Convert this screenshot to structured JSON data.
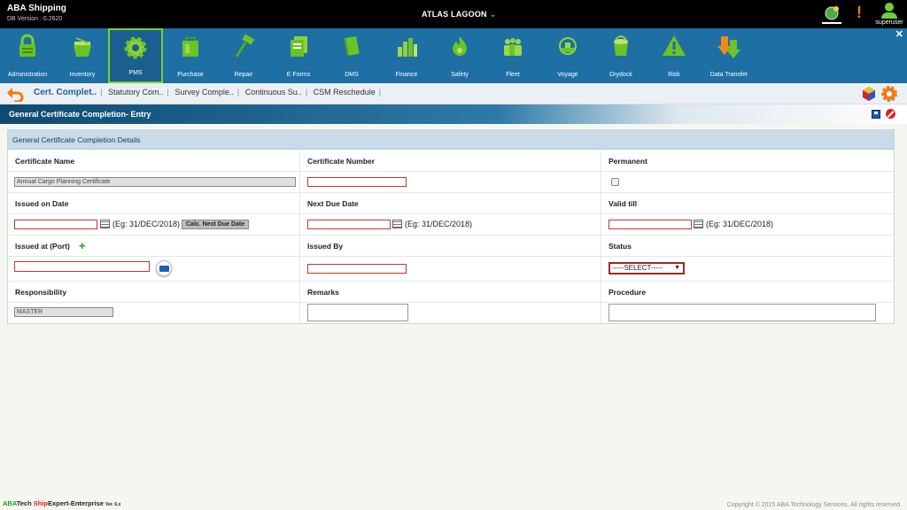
{
  "app": {
    "name": "ABA Shipping",
    "version": "DB Version : 0.2620",
    "vessel": "ATLAS LAGOON",
    "user": "superuser"
  },
  "modules": [
    {
      "label": "Administration",
      "icon": "lock-icon"
    },
    {
      "label": "Inventory",
      "icon": "basket-icon"
    },
    {
      "label": "PMS",
      "icon": "gear-icon",
      "active": true
    },
    {
      "label": "Purchase",
      "icon": "shopping-bag-icon"
    },
    {
      "label": "Repair",
      "icon": "hammer-icon"
    },
    {
      "label": "E Forms",
      "icon": "forms-icon"
    },
    {
      "label": "DMS",
      "icon": "book-icon"
    },
    {
      "label": "Finance",
      "icon": "bar-chart-icon"
    },
    {
      "label": "Safety",
      "icon": "flame-icon"
    },
    {
      "label": "Fleet",
      "icon": "people-icon"
    },
    {
      "label": "Voyage",
      "icon": "ship-icon"
    },
    {
      "label": "Drydock",
      "icon": "paint-bucket-icon"
    },
    {
      "label": "Risk",
      "icon": "warning-icon"
    },
    {
      "label": "Data Transfer",
      "icon": "transfer-arrow-icon"
    }
  ],
  "tabs": [
    "Cert. Complet..",
    "Statutory Com..",
    "Survey Comple..",
    "Continuous Su..",
    "CSM Reschedule"
  ],
  "section_title": "General Certificate Completion- Entry",
  "panel_title": "General Certificate Completion Details",
  "form": {
    "certificate_name_label": "Certificate Name",
    "certificate_name_value": "Annual Cargo Planning Certificate",
    "certificate_number_label": "Certificate Number",
    "permanent_label": "Permanent",
    "issued_on_label": "Issued on Date",
    "next_due_label": "Next Due Date",
    "valid_till_label": "Valid till",
    "date_hint": "(Eg: 31/DEC/2018)",
    "calc_button": "Calc. Next Due Date",
    "issued_at_label": "Issued at (Port)",
    "issued_by_label": "Issued By",
    "status_label": "Status",
    "status_value": "-----SELECT-----",
    "responsibility_label": "Responsibility",
    "responsibility_value": "MASTER",
    "remarks_label": "Remarks",
    "procedure_label": "Procedure"
  },
  "footer": {
    "logo_a": "ABA",
    "logo_b": "Tech ",
    "logo_c": "Ship",
    "logo_d": "Expert-Enterprise",
    "logo_ver": "Ver. 6.x",
    "copyright": "Copyright © 2015 ABA Technology Services. All rights reserved."
  },
  "colors": {
    "modbar": "#1d6fa4",
    "accent_green": "#7ccf2d",
    "required_border": "#c0392b"
  }
}
